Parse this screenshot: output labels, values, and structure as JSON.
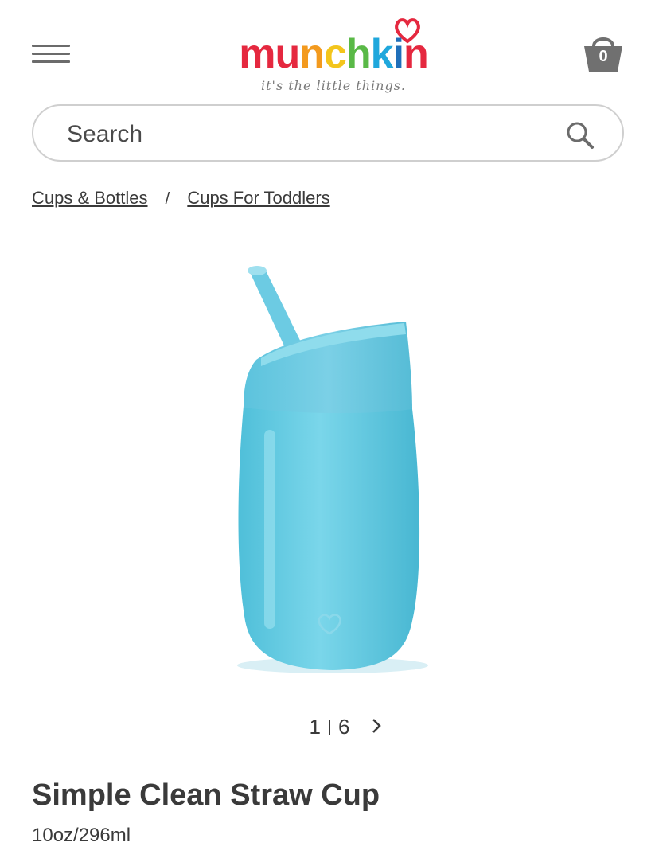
{
  "header": {
    "logo_text": "munchkin",
    "logo_letters": [
      {
        "ch": "m",
        "color": "#e5283f"
      },
      {
        "ch": "u",
        "color": "#e5283f"
      },
      {
        "ch": "n",
        "color": "#f39a1e"
      },
      {
        "ch": "c",
        "color": "#f3c51c"
      },
      {
        "ch": "h",
        "color": "#5ab947"
      },
      {
        "ch": "k",
        "color": "#1fa7dc"
      },
      {
        "ch": "i",
        "color": "#1f6fba"
      },
      {
        "ch": "n",
        "color": "#e5283f"
      }
    ],
    "tagline": "it's the little things.",
    "cart_count": "0",
    "menu_icon": "hamburger-menu-icon",
    "cart_icon": "shopping-basket-icon"
  },
  "search": {
    "placeholder": "Search",
    "icon": "search-icon"
  },
  "breadcrumb": {
    "items": [
      "Cups & Bottles",
      "Cups For Toddlers"
    ],
    "separator": "/"
  },
  "gallery": {
    "current": "1",
    "total": "6",
    "next_icon": "chevron-right-icon"
  },
  "product": {
    "title": "Simple Clean Straw Cup",
    "size": "10oz/296ml",
    "cup_color": "#5cc8e0"
  }
}
